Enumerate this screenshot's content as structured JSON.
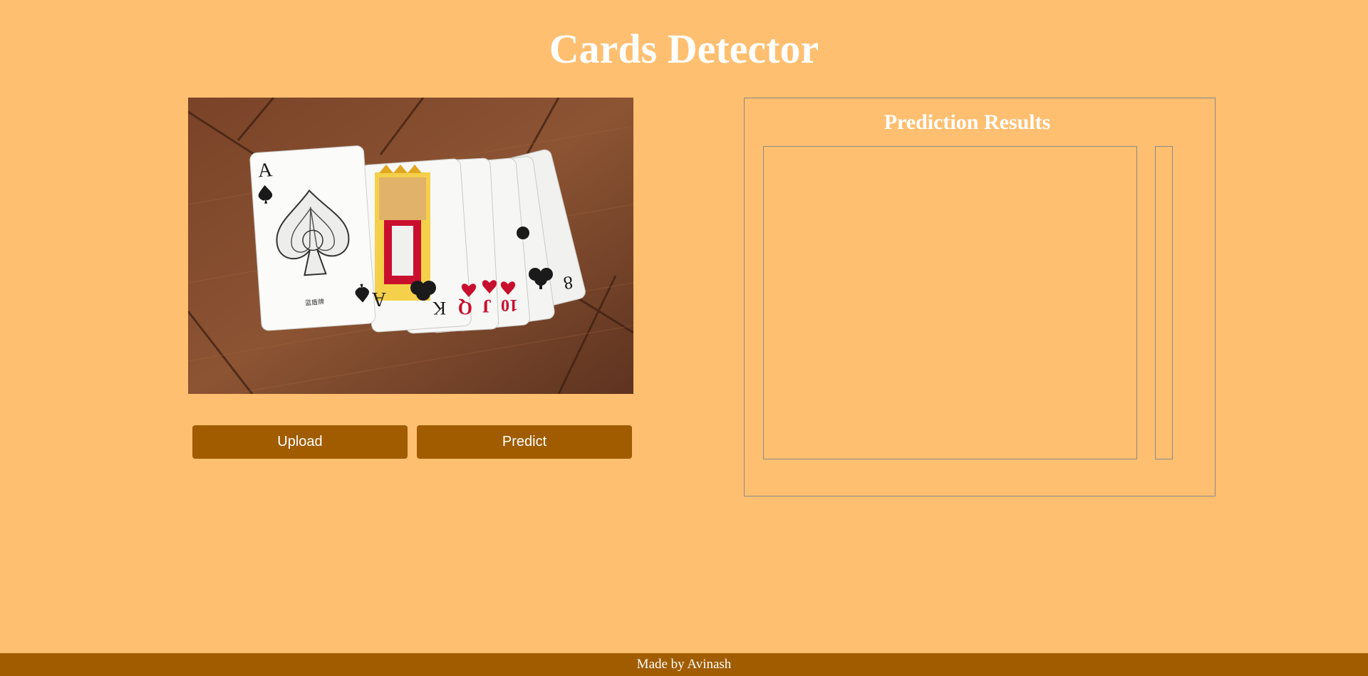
{
  "header": {
    "title": "Cards Detector"
  },
  "preview": {
    "image_description_icon": "playing-cards-photo",
    "cards": {
      "ace": {
        "rank": "A",
        "brand": "蓝盾牌"
      },
      "king": {
        "rank": "K"
      },
      "queen": {
        "rank": "Q"
      },
      "jack": {
        "rank": "J"
      },
      "ten": {
        "rank": "10"
      },
      "eight": {
        "rank": "8"
      }
    }
  },
  "actions": {
    "upload_label": "Upload",
    "predict_label": "Predict"
  },
  "results": {
    "title": "Prediction Results"
  },
  "footer": {
    "text": "Made by Avinash"
  },
  "colors": {
    "background": "#ffbf70",
    "accent": "#a15c00",
    "text": "#ffffff",
    "border": "#8a8a8a"
  }
}
